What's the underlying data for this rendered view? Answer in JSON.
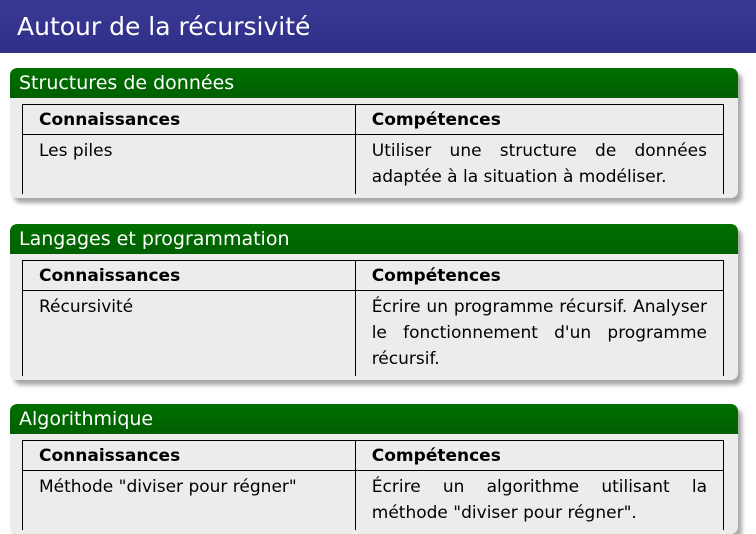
{
  "frame": {
    "title": "Autour de la récursivité"
  },
  "blocks": [
    {
      "title": "Structures de données",
      "head": [
        "Connaissances",
        "Compétences"
      ],
      "rows": [
        {
          "knowledge": "Les piles",
          "skills": "Utiliser une structure de données adaptée à la situation à modéliser."
        }
      ]
    },
    {
      "title": "Langages et programmation",
      "head": [
        "Connaissances",
        "Compétences"
      ],
      "rows": [
        {
          "knowledge": "Récursivité",
          "skills": "Écrire un programme récursif. Analyser le fonctionnement d'un programme récursif."
        }
      ]
    },
    {
      "title": "Algorithmique",
      "head": [
        "Connaissances",
        "Compétences"
      ],
      "rows": [
        {
          "knowledge": "Méthode \"diviser pour régner\"",
          "skills": "Écrire un algorithme utilisant la méthode \"diviser pour régner\"."
        }
      ]
    }
  ],
  "colors": {
    "frame_title_bg": "#2f2f88",
    "block_header_bg": "#006400",
    "block_body_bg": "#ececec"
  }
}
